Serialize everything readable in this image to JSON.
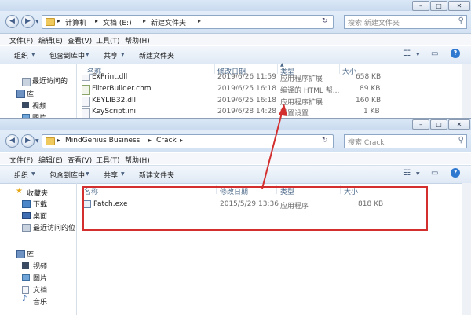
{
  "back_window": {
    "path": [
      "计算机",
      "文档 (E:)",
      "新建文件夹"
    ],
    "search_placeholder": "搜索 新建文件夹",
    "menus": [
      "文件(F)",
      "编辑(E)",
      "查看(V)",
      "工具(T)",
      "帮助(H)"
    ],
    "toolbar": [
      "组织",
      "包含到库中",
      "共享",
      "新建文件夹"
    ],
    "columns": [
      "名称",
      "修改日期",
      "类型",
      "大小"
    ],
    "nav": [
      "最近访问的",
      "库",
      "视频",
      "图片"
    ],
    "files": [
      {
        "name": "ExPrint.dll",
        "date": "2019/6/26 11:59",
        "type": "应用程序扩展",
        "size": "658 KB"
      },
      {
        "name": "FilterBuilder.chm",
        "date": "2019/6/25 16:18",
        "type": "编译的 HTML 帮...",
        "size": "89 KB"
      },
      {
        "name": "KEYLIB32.dll",
        "date": "2019/6/25 16:18",
        "type": "应用程序扩展",
        "size": "160 KB"
      },
      {
        "name": "KeyScript.ini",
        "date": "2019/6/28 14:28",
        "type": "配置设置",
        "size": "1 KB"
      }
    ]
  },
  "front_window": {
    "path": [
      "MindGenius Business",
      "Crack"
    ],
    "search_placeholder": "搜索 Crack",
    "menus": [
      "文件(F)",
      "编辑(E)",
      "查看(V)",
      "工具(T)",
      "帮助(H)"
    ],
    "toolbar": [
      "组织",
      "包含到库中",
      "共享",
      "新建文件夹"
    ],
    "columns": [
      "名称",
      "修改日期",
      "类型",
      "大小"
    ],
    "nav": {
      "favorites": "收藏夹",
      "favorite_items": [
        "下载",
        "桌面",
        "最近访问的位"
      ],
      "libraries": "库",
      "library_items": [
        "视频",
        "图片",
        "文档",
        "音乐"
      ]
    },
    "file": {
      "name": "Patch.exe",
      "date": "2015/5/29 13:36",
      "type": "应用程序",
      "size": "818 KB"
    }
  },
  "annotation": {
    "color": "#d32f2f"
  }
}
